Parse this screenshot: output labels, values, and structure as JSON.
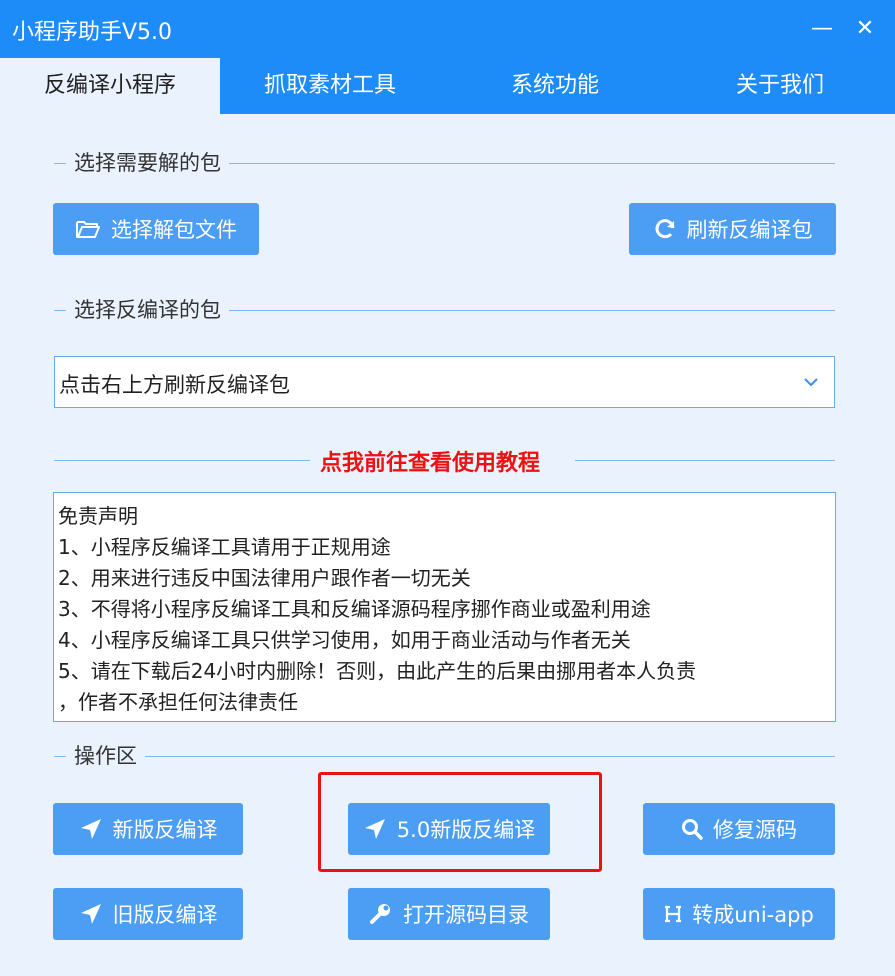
{
  "app": {
    "title": "小程序助手V5.0",
    "minimize": "—",
    "close": "✕"
  },
  "tabs": [
    {
      "label": "反编译小程序",
      "active": true
    },
    {
      "label": "抓取素材工具",
      "active": false
    },
    {
      "label": "系统功能",
      "active": false
    },
    {
      "label": "关于我们",
      "active": false
    }
  ],
  "sections": {
    "select_package": "选择需要解的包",
    "select_decompile": "选择反编译的包",
    "operations": "操作区"
  },
  "buttons": {
    "select_file": "选择解包文件",
    "refresh": "刷新反编译包",
    "new_decompile": "新版反编译",
    "v5_decompile": "5.0新版反编译",
    "repair": "修复源码",
    "old_decompile": "旧版反编译",
    "open_dir": "打开源码目录",
    "to_uniapp": "转成uni-app"
  },
  "dropdown": {
    "value": "点击右上方刷新反编译包"
  },
  "tutorial_link": "点我前往查看使用教程",
  "disclaimer": [
    "免责声明",
    " 1、小程序反编译工具请用于正规用途",
    " 2、用来进行违反中国法律用户跟作者一切无关",
    " 3、不得将小程序反编译工具和反编译源码程序挪作商业或盈利用途",
    " 4、小程序反编译工具只供学习使用，如用于商业活动与作者无关",
    " 5、请在下载后24小时内删除！否则，由此产生的后果由挪用者本人负责",
    "，作者不承担任何法律责任"
  ],
  "colors": {
    "primary": "#1e8cf8",
    "button": "#4b9ef3",
    "background": "#e9f2fd",
    "highlight": "#ee1111"
  },
  "icons": {
    "select_file": "folder-open-icon",
    "refresh": "refresh-icon",
    "new_decompile": "paper-plane-icon",
    "v5_decompile": "paper-plane-icon",
    "repair": "search-icon",
    "old_decompile": "paper-plane-icon",
    "open_dir": "wrench-icon",
    "to_uniapp": "h-icon"
  }
}
